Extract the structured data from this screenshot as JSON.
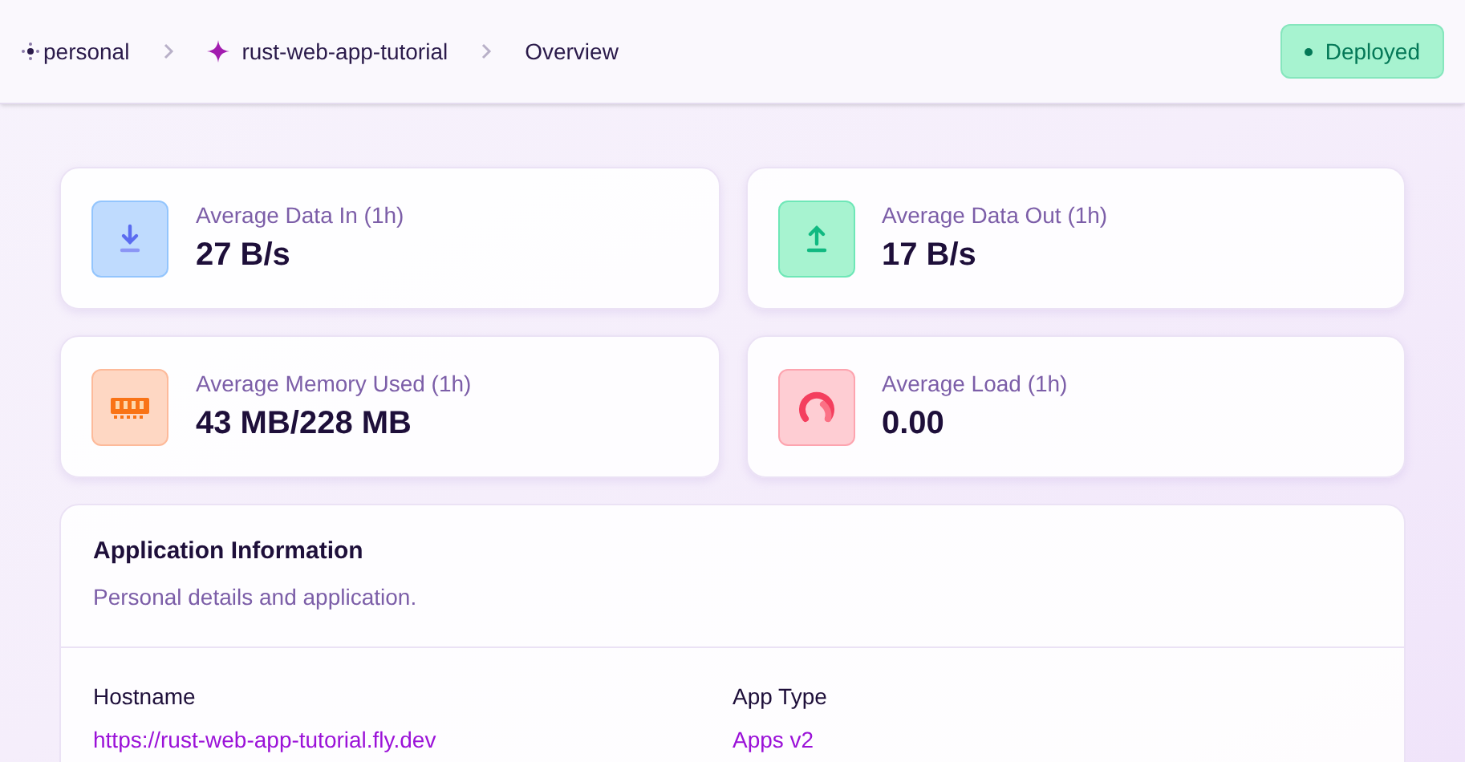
{
  "breadcrumbs": [
    {
      "label": "personal",
      "kind": "org"
    },
    {
      "label": "rust-web-app-tutorial",
      "kind": "app"
    },
    {
      "label": "Overview",
      "kind": "page"
    }
  ],
  "status": {
    "label": "Deployed"
  },
  "stats": [
    {
      "kind": "download",
      "label": "Average Data In (1h)",
      "value": "27 B/s"
    },
    {
      "kind": "upload",
      "label": "Average Data Out (1h)",
      "value": "17 B/s"
    },
    {
      "kind": "memory",
      "label": "Average Memory Used (1h)",
      "value": "43 MB/228 MB"
    },
    {
      "kind": "load",
      "label": "Average Load (1h)",
      "value": "0.00"
    }
  ],
  "info": {
    "title": "Application Information",
    "subtitle": "Personal details and application.",
    "fields": [
      {
        "label": "Hostname",
        "value": "https://rust-web-app-tutorial.fly.dev"
      },
      {
        "label": "App Type",
        "value": "Apps v2"
      }
    ]
  }
}
